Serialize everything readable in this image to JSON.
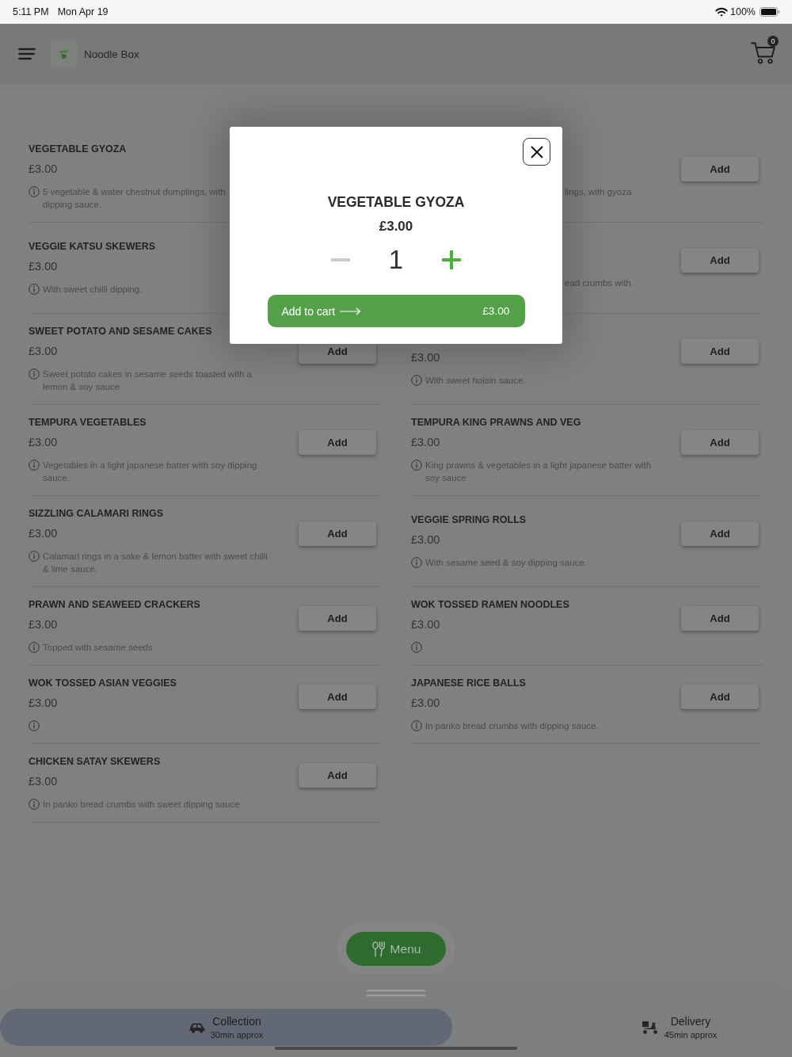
{
  "status_bar": {
    "time": "5:11 PM",
    "date": "Mon Apr 19",
    "battery": "100%"
  },
  "header": {
    "title": "Noodle Box",
    "cart_count": "0"
  },
  "menu": {
    "left": [
      {
        "kind": "full",
        "name": "VEGETABLE GYOZA",
        "price": "£3.00",
        "description": "5 vegetable & water chestnut dumplings, with\ndipping sauce."
      },
      {
        "kind": "full",
        "name": "VEGGIE KATSU SKEWERS",
        "price": "£3.00",
        "description": "With sweet chilli dipping."
      },
      {
        "kind": "full",
        "name": "SWEET POTATO AND SESAME CAKES",
        "price": "£3.00",
        "description": "Sweet potato cakes in sesame seeds toasted with a\nlemon & soy sauce",
        "add_button": "Add"
      },
      {
        "kind": "full",
        "name": "TEMPURA VEGETABLES",
        "price": "£3.00",
        "description": "Vegetables in a light japanese batter with soy dipping\nsauce.",
        "add_button": "Add"
      },
      {
        "kind": "full",
        "name": "SIZZLING CALAMARI RINGS",
        "price": "£3.00",
        "description": "Calamari rings in a sake & lemon batter with sweet chilli\n& lime sauce.",
        "add_button": "Add"
      },
      {
        "kind": "full",
        "name": "PRAWN AND SEAWEED CRACKERS",
        "price": "£3.00",
        "description": "Topped with sesame seeds",
        "add_button": "Add"
      },
      {
        "kind": "full",
        "name": "WOK TOSSED ASIAN VEGGIES",
        "price": "£3.00",
        "add_button": "Add"
      },
      {
        "kind": "full",
        "name": "CHICKEN SATAY SKEWERS",
        "price": "£3.00",
        "description": "In panko bread crumbs with sweet dipping sauce",
        "add_button": "Add"
      }
    ],
    "right": [
      {
        "kind": "fragment",
        "description": "lings, with gyoza",
        "add_button": "Add"
      },
      {
        "kind": "fragment",
        "description": "ead crumbs with",
        "add_button": "Add"
      },
      {
        "kind": "untitled",
        "price": "£3.00",
        "description": "With sweet hoisin sauce.",
        "add_button": "Add"
      },
      {
        "kind": "full",
        "name": "TEMPURA KING PRAWNS AND VEG",
        "price": "£3.00",
        "description": "King prawns & vegetables in a light japanese batter with\nsoy sauce",
        "add_button": "Add"
      },
      {
        "kind": "full",
        "name": "VEGGIE SPRING ROLLS",
        "price": "£3.00",
        "description": "With sesame seed & soy dipping sauce.",
        "add_button": "Add"
      },
      {
        "kind": "full",
        "name": "WOK TOSSED RAMEN NOODLES",
        "price": "£3.00",
        "add_button": "Add"
      },
      {
        "kind": "full",
        "name": "JAPANESE RICE BALLS",
        "price": "£3.00",
        "description": "In panko bread crumbs with dipping sauce.",
        "add_button": "Add"
      }
    ]
  },
  "dialog": {
    "title": "VEGETABLE GYOZA",
    "price": "£3.00",
    "quantity": "1",
    "decrease_disabled": true,
    "add_to_cart": {
      "label": "Add to cart",
      "total": "£3.00"
    }
  },
  "menu_button": {
    "label": "Menu"
  },
  "order_modes": [
    {
      "kind": "collection",
      "label": "Collection",
      "time": "30min approx",
      "selected": true
    },
    {
      "kind": "delivery",
      "label": "Delivery",
      "time": "45min approx",
      "selected": false
    }
  ]
}
